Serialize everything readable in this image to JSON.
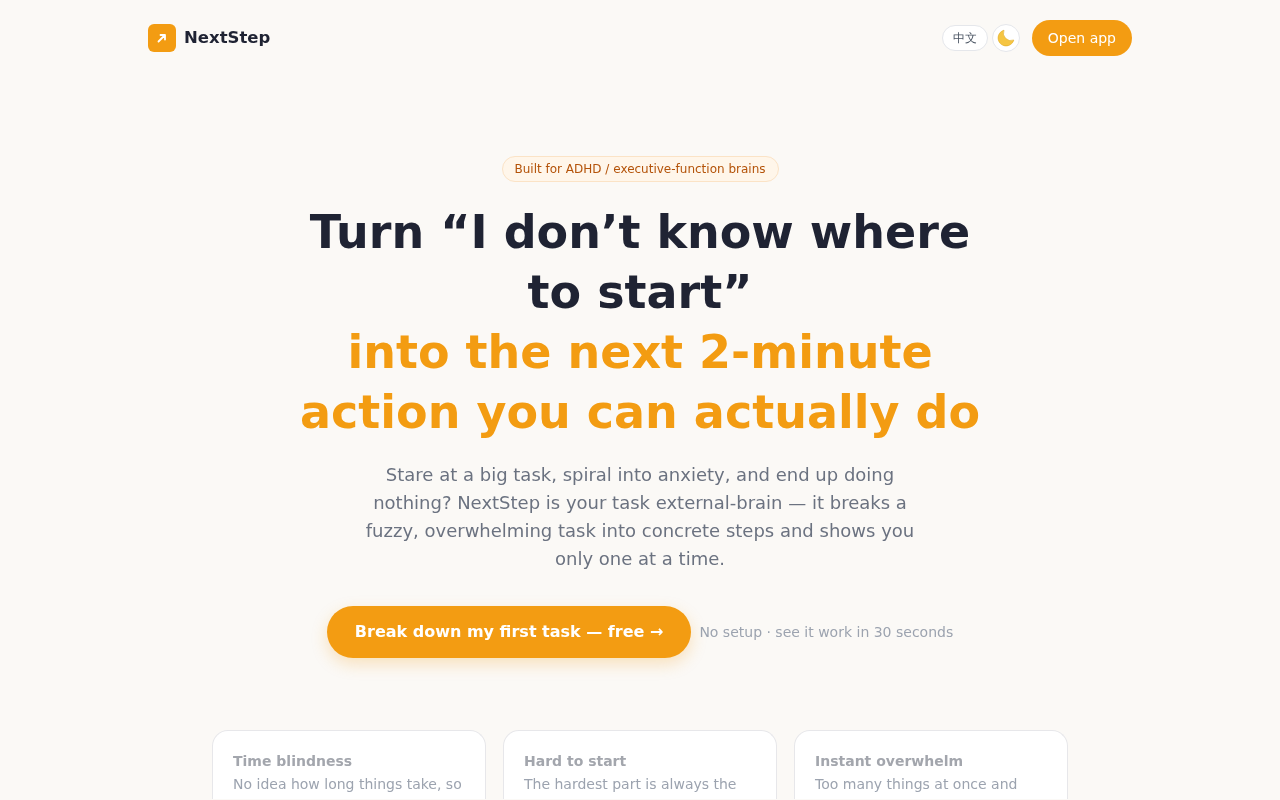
{
  "nav": {
    "brand": "NextStep",
    "language_button": "中文",
    "open_app_button": "Open app"
  },
  "hero": {
    "badge": "Built for ADHD / executive-function brains",
    "title": "Turn “I don’t know where to start”",
    "title_highlight": "into the next 2-minute action you can actually do",
    "description": "Stare at a big task, spiral into anxiety, and end up doing nothing? NextStep is your task external-brain — it breaks a fuzzy, overwhelming task into concrete steps and shows you only one at a time.",
    "cta_button": "Break down my first task — free →",
    "cta_note": "No setup · see it work in 30 seconds"
  },
  "feature_cards": [
    {
      "title": "Time blindness",
      "text": "No idea how long things take, so"
    },
    {
      "title": "Hard to start",
      "text": "The hardest part is always the"
    },
    {
      "title": "Instant overwhelm",
      "text": "Too many things at once and"
    }
  ]
}
